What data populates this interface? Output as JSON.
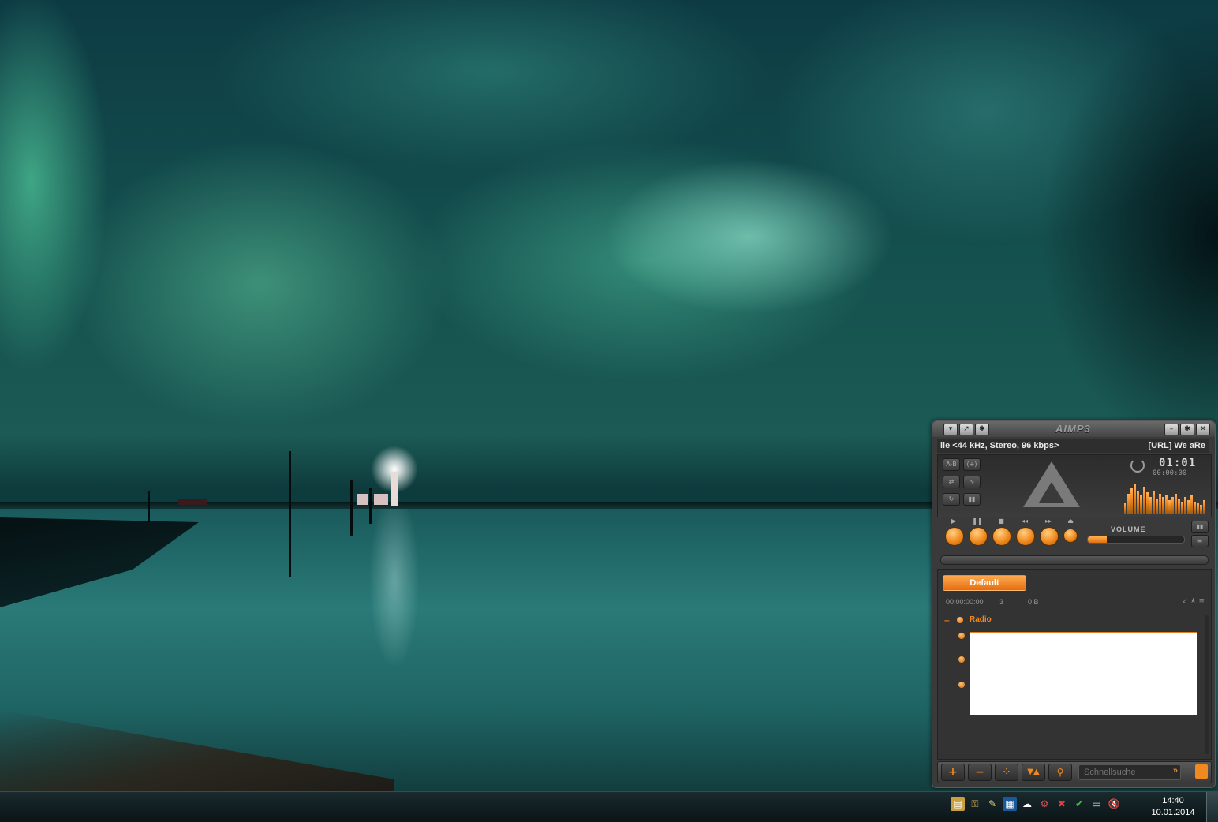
{
  "player": {
    "logo": "AIMP3",
    "title_buttons_left": [
      "▾",
      "↗",
      "✱"
    ],
    "title_buttons_right": [
      "–",
      "✱",
      "✕"
    ],
    "marquee_left": "ile <44 kHz, Stereo, 96 kbps>",
    "marquee_right": "[URL] We aRe",
    "time_main": "01:01",
    "time_sub": "00:00:00",
    "controls": [
      {
        "name": "play",
        "symbol": "▶"
      },
      {
        "name": "pause",
        "symbol": "❚❚"
      },
      {
        "name": "stop",
        "symbol": "■"
      },
      {
        "name": "previous",
        "symbol": "◂◂"
      },
      {
        "name": "next",
        "symbol": "▸▸"
      },
      {
        "name": "open",
        "symbol": "⏏"
      }
    ],
    "volume_label": "VOLUME",
    "volume_level": 0.2,
    "spectrum_levels": [
      0.3,
      0.6,
      0.75,
      0.9,
      0.7,
      0.55,
      0.8,
      0.65,
      0.5,
      0.7,
      0.45,
      0.6,
      0.5,
      0.55,
      0.4,
      0.5,
      0.6,
      0.45,
      0.35,
      0.5,
      0.4,
      0.55,
      0.35,
      0.3,
      0.25,
      0.4
    ]
  },
  "playlist": {
    "tab_label": "Default",
    "duration": "00:00:00:00",
    "count": "3",
    "size": "0 B",
    "group_label": "Radio",
    "search_placeholder": "Schnellsuche",
    "search_go": "»"
  },
  "taskbar": {
    "time": "14:40",
    "date": "10.01.2014",
    "tray_icons": [
      "folder-icon",
      "lock-icon",
      "pen-icon",
      "network-icon",
      "cloud-icon",
      "bike-icon",
      "flag-icon",
      "shield-icon",
      "window-icon",
      "volume-mute-icon"
    ]
  }
}
